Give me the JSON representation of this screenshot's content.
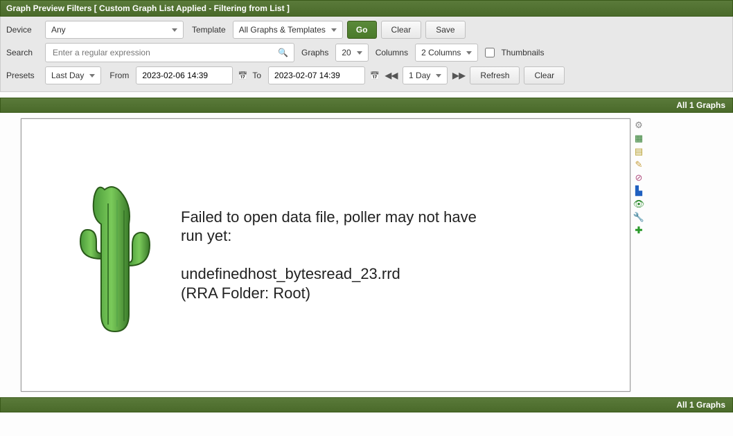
{
  "header": {
    "title": "Graph Preview Filters [ Custom Graph List Applied - Filtering from List ]"
  },
  "filters": {
    "device_label": "Device",
    "device_value": "Any",
    "template_label": "Template",
    "template_value": "All Graphs & Templates",
    "go_label": "Go",
    "clear_label": "Clear",
    "save_label": "Save",
    "search_label": "Search",
    "search_placeholder": "Enter a regular expression",
    "graphs_label": "Graphs",
    "graphs_value": "20",
    "columns_label": "Columns",
    "columns_value": "2 Columns",
    "thumbnails_label": "Thumbnails",
    "presets_label": "Presets",
    "presets_value": "Last Day",
    "from_label": "From",
    "from_value": "2023-02-06 14:39",
    "to_label": "To",
    "to_value": "2023-02-07 14:39",
    "span_value": "1 Day",
    "refresh_label": "Refresh",
    "clear2_label": "Clear"
  },
  "status_bar": "All 1 Graphs",
  "graph": {
    "error_line1": "Failed to open data file, poller may not have run yet:",
    "error_line2": "undefinedhost_bytesread_23.rrd",
    "error_line3": "(RRA Folder: Root)"
  },
  "side_icons": [
    {
      "name": "gear-icon",
      "glyph": "⚙"
    },
    {
      "name": "csv-export-icon",
      "glyph": "▦"
    },
    {
      "name": "page-icon",
      "glyph": "▤"
    },
    {
      "name": "edit-icon",
      "glyph": "✎"
    },
    {
      "name": "zoom-icon",
      "glyph": "⊘"
    },
    {
      "name": "chart-icon",
      "glyph": "▙"
    },
    {
      "name": "eye-icon",
      "glyph": "👁"
    },
    {
      "name": "wrench-icon",
      "glyph": "🔧"
    },
    {
      "name": "add-icon",
      "glyph": "✚"
    }
  ]
}
